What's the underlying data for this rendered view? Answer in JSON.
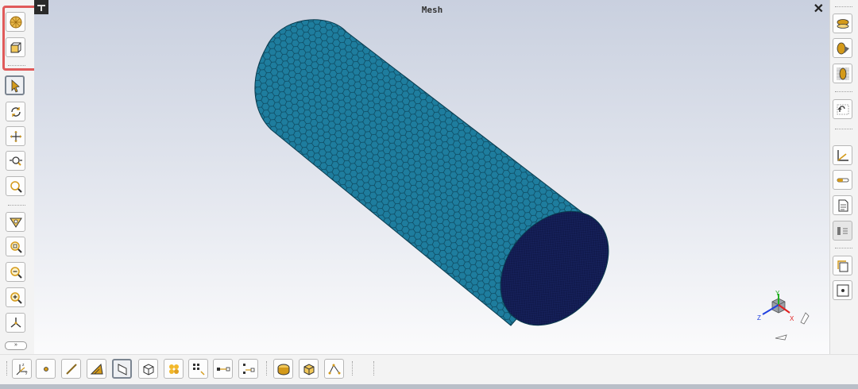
{
  "viewport": {
    "title": "Mesh",
    "close_symbol": "✕"
  },
  "triad": {
    "x_label": "X",
    "y_label": "Y",
    "z_label": "Z"
  },
  "left_toolbar": {
    "expander_symbol": "»",
    "icons": [
      "mesh-sphere-icon",
      "cube-view-icon",
      "select-arrow-icon",
      "rotate-icon",
      "pan-icon",
      "zoom-icon",
      "zoom-window-icon",
      "view-filter-icon",
      "zoom-fit-icon",
      "zoom-out-icon",
      "zoom-in-icon",
      "axis-view-icon"
    ]
  },
  "right_toolbar": {
    "icons": [
      "section-plane-icon",
      "clip-shape-icon",
      "transparency-icon",
      "undo-view-icon",
      "axis-icon",
      "slider-icon",
      "notes-icon",
      "properties-icon",
      "copy-frame-icon",
      "point-target-icon"
    ]
  },
  "bottom_toolbar": {
    "icons": [
      "coordinate-system-icon",
      "vertex-icon",
      "edge-icon",
      "angle-icon",
      "face-icon",
      "body-icon",
      "mesh-nodes-icon",
      "node-select-icon",
      "node-to-node-icon",
      "node-connect-icon",
      "shaded-face-icon",
      "box-body-icon",
      "sketch-nodes-icon"
    ]
  },
  "colors": {
    "mesh_fill": "#1a7a9a",
    "mesh_end_cap": "#121a4e",
    "accent_icon": "#d49a1a",
    "highlight": "#e05a5a"
  }
}
